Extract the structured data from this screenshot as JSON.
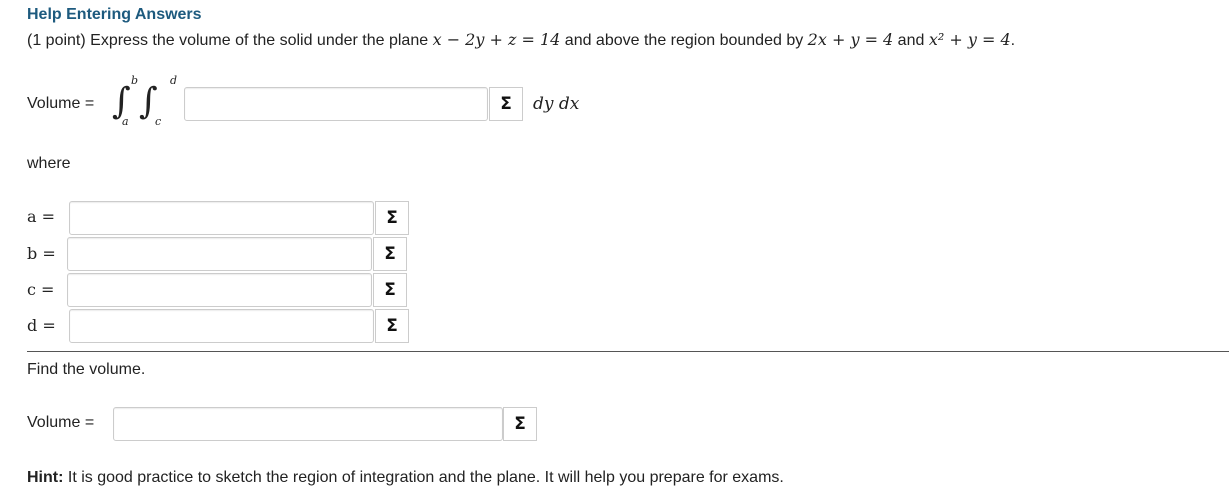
{
  "header": {
    "help_link": "Help Entering Answers"
  },
  "problem": {
    "part1": "(1 point) Express the volume of the solid under the plane ",
    "plane_eq": "x − 2y + z = 14",
    "part2": " and above the region bounded by ",
    "eq1": "2x + y = 4",
    "and_text": " and ",
    "eq2": "x² + y = 4",
    "end": "."
  },
  "volume_integral": {
    "label": "Volume =",
    "outer_upper": "b",
    "outer_lower": "a",
    "inner_upper": "d",
    "inner_lower": "c",
    "integral_symbol": "∫",
    "value": "",
    "differentials": "dy dx"
  },
  "where_text": "where",
  "limits": [
    {
      "label": "a =",
      "value": ""
    },
    {
      "label": "b =",
      "value": ""
    },
    {
      "label": "c =",
      "value": ""
    },
    {
      "label": "d =",
      "value": ""
    }
  ],
  "sigma_glyph": "Σ",
  "find_text": "Find the volume.",
  "volume_answer": {
    "label": "Volume =",
    "value": ""
  },
  "hint": {
    "bold": "Hint:",
    "text": " It is good practice to sketch the region of integration and the plane. It will help you prepare for exams."
  }
}
